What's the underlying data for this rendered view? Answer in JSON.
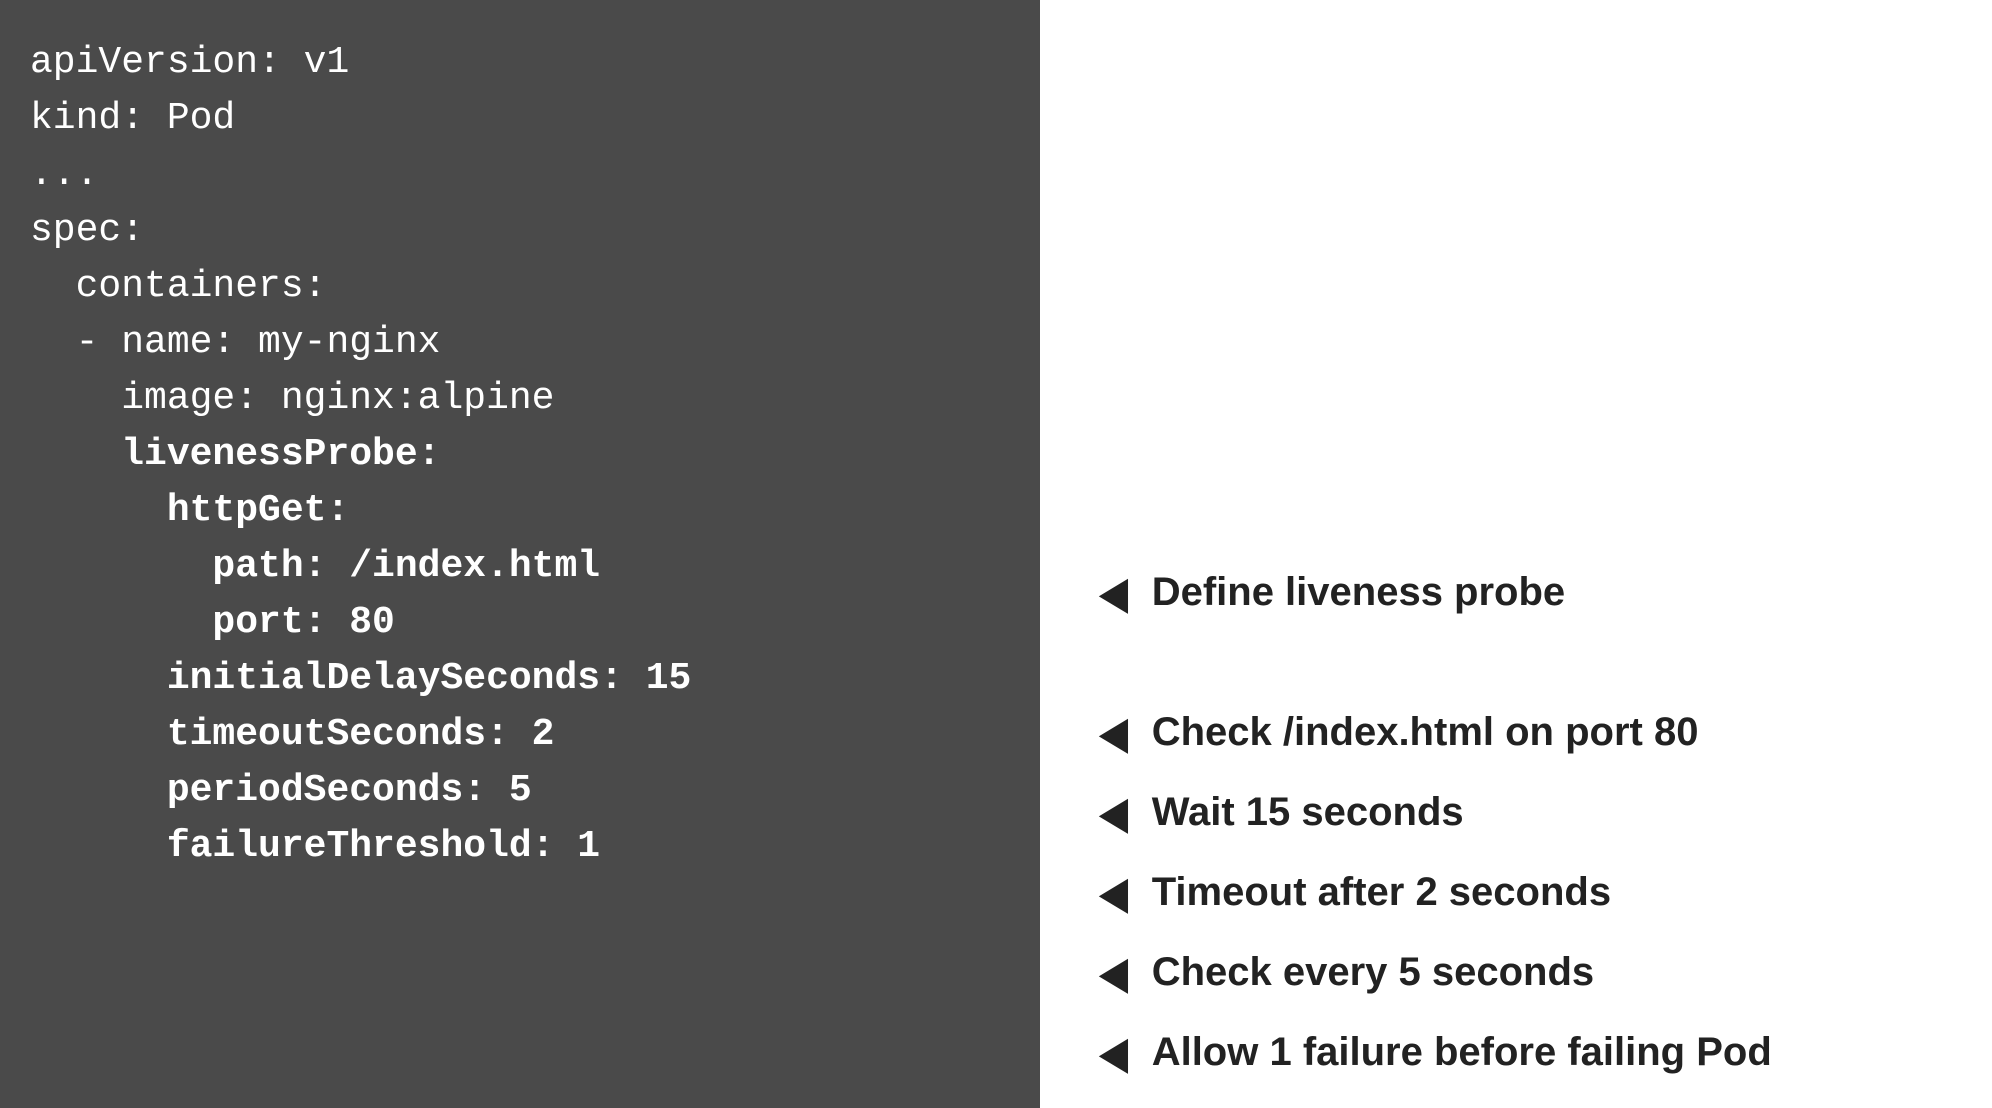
{
  "code": {
    "l1": "apiVersion: v1",
    "l2": "",
    "l3": "kind: Pod",
    "l4": "",
    "l5": "...",
    "l6": "",
    "l7": "spec:",
    "l8": "  containers:",
    "l9": "  - name: my-nginx",
    "l10": "    image: nginx:alpine",
    "l11": "    livenessProbe:",
    "l12": "      httpGet:",
    "l13": "        path: /index.html",
    "l14": "        port: 80",
    "l15": "      initialDelaySeconds: 15",
    "l16": "      timeoutSeconds: 2",
    "l17": "      periodSeconds: 5",
    "l18": "      failureThreshold: 1"
  },
  "annots": {
    "pointer": "◀",
    "a1": "Define liveness probe",
    "a2": "Check /index.html on port 80",
    "a3": "Wait 15 seconds",
    "a4": "Timeout after 2 seconds",
    "a5": "Check every 5 seconds",
    "a6": "Allow 1 failure before failing Pod"
  }
}
